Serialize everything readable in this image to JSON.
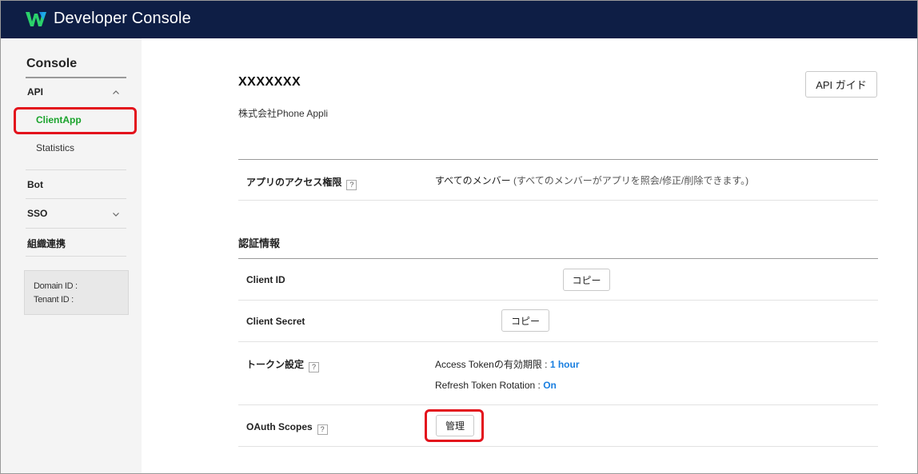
{
  "header": {
    "title": "Developer Console",
    "logo_icon": "works-logo-icon",
    "background": "#0e1e45"
  },
  "sidebar": {
    "title": "Console",
    "items": [
      {
        "label": "API",
        "expanded": true,
        "children": [
          {
            "label": "ClientApp",
            "active": true
          },
          {
            "label": "Statistics",
            "active": false
          }
        ]
      },
      {
        "label": "Bot"
      },
      {
        "label": "SSO",
        "expanded": false
      },
      {
        "label": "組織連携"
      }
    ],
    "domain_info": {
      "domain_label": "Domain ID :",
      "tenant_label": "Tenant ID :"
    },
    "accent_color": "#1aa32c"
  },
  "main": {
    "app_name": "XXXXXXX",
    "company": "株式会社Phone Appli",
    "api_guide_button": "API ガイド",
    "access": {
      "label": "アプリのアクセス権限",
      "value": "すべてのメンバー",
      "note": "(すべてのメンバーがアプリを照会/修正/削除できます。)"
    },
    "auth_section_title": "認証情報",
    "client_id": {
      "label": "Client ID",
      "button": "コピー"
    },
    "client_secret": {
      "label": "Client Secret",
      "button": "コピー"
    },
    "token": {
      "label": "トークン設定",
      "access_prefix": "Access Tokenの有効期限 :",
      "access_value": "1 hour",
      "refresh_prefix": "Refresh Token Rotation :",
      "refresh_value": "On"
    },
    "oauth": {
      "label": "OAuth Scopes",
      "button": "管理"
    },
    "help_glyph": "?"
  },
  "colors": {
    "highlight": "#e3121c",
    "value_blue": "#1a7fe0"
  }
}
